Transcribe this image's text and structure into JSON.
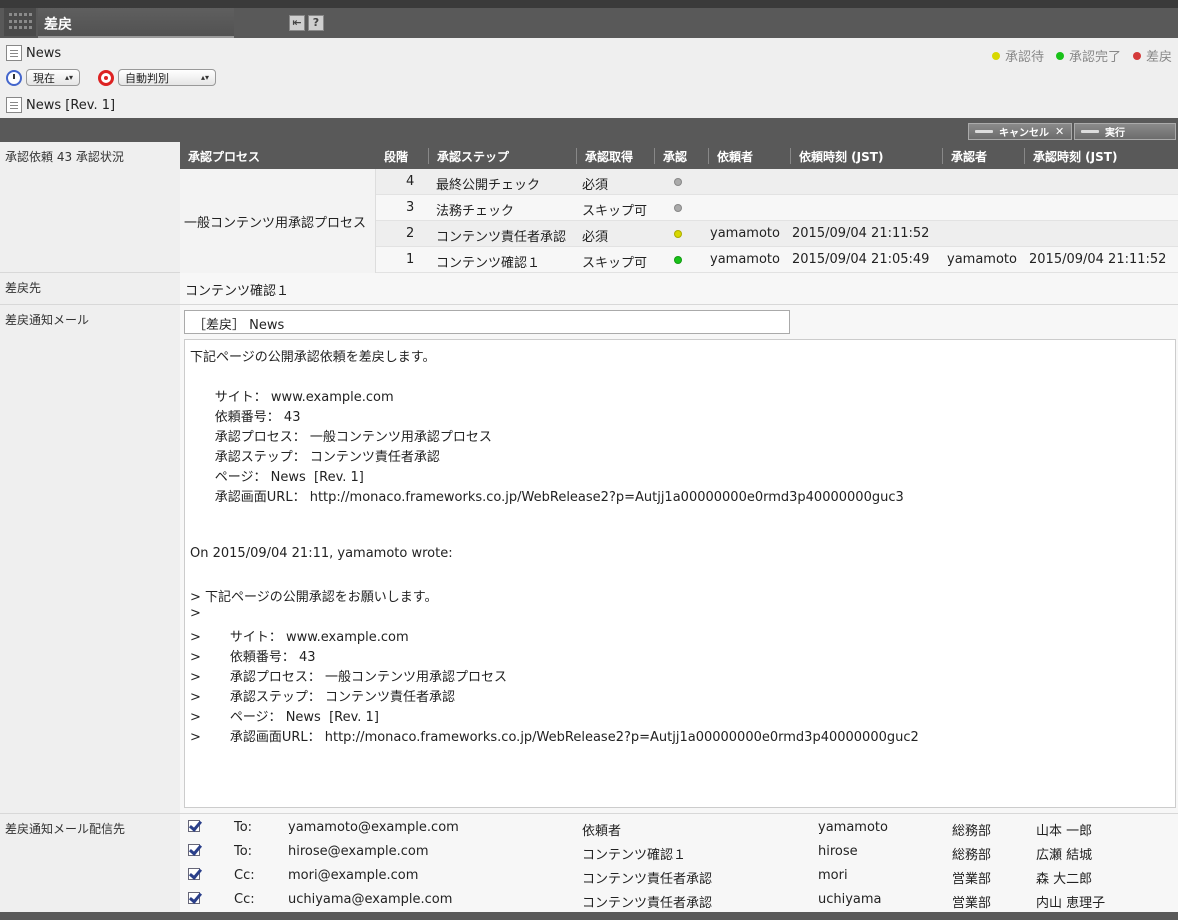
{
  "window": {
    "title": "差戻"
  },
  "header": {
    "page_name": "News",
    "time_select": "現在",
    "mode_select": "自動判別",
    "revision": "News [Rev. 1]",
    "legend": [
      {
        "label": "承認待",
        "color": "#d8d800"
      },
      {
        "label": "承認完了",
        "color": "#19c219"
      },
      {
        "label": "差戻",
        "color": "#d43a3a"
      }
    ]
  },
  "toolbar": {
    "cancel_label": "キャンセル",
    "execute_label": "実行"
  },
  "approval": {
    "label": "承認依頼 43 承認状況",
    "columns": [
      "承認プロセス",
      "段階",
      "承認ステップ",
      "承認取得",
      "承認",
      "依頼者",
      "依頼時刻 (JST)",
      "承認者",
      "承認時刻 (JST)"
    ],
    "process_name": "一般コンテンツ用承認プロセス",
    "rows": [
      {
        "stage": "4",
        "step": "最終公開チェック",
        "requirement": "必須",
        "status_color": "#aaaaaa",
        "requester": "",
        "request_time": "",
        "approver": "",
        "approve_time": ""
      },
      {
        "stage": "3",
        "step": "法務チェック",
        "requirement": "スキップ可",
        "status_color": "#aaaaaa",
        "requester": "",
        "request_time": "",
        "approver": "",
        "approve_time": ""
      },
      {
        "stage": "2",
        "step": "コンテンツ責任者承認",
        "requirement": "必須",
        "status_color": "#d8d800",
        "requester": "yamamoto",
        "request_time": "2015/09/04 21:11:52",
        "approver": "",
        "approve_time": ""
      },
      {
        "stage": "1",
        "step": "コンテンツ確認１",
        "requirement": "スキップ可",
        "status_color": "#19c219",
        "requester": "yamamoto",
        "request_time": "2015/09/04 21:05:49",
        "approver": "yamamoto",
        "approve_time": "2015/09/04 21:11:52"
      }
    ]
  },
  "return_to": {
    "label": "差戻先",
    "value": "コンテンツ確認１"
  },
  "mail": {
    "label": "差戻通知メール",
    "subject": "［差戻］ News",
    "body_lines": [
      "下記ページの公開承認依頼を差戻します。",
      "",
      "      サイト： www.example.com",
      "      依頼番号： 43",
      "      承認プロセス： 一般コンテンツ用承認プロセス",
      "      承認ステップ： コンテンツ責任者承認",
      "      ページ： News  [Rev. 1]",
      "      承認画面URL： http://monaco.frameworks.co.jp/WebRelease2?p=Autjj1a00000000e0rmd3p40000000guc3",
      "",
      "",
      "On 2015/09/04 21:11, yamamoto wrote:",
      "",
      "> 下記ページの公開承認をお願いします。",
      ">",
      ">       サイト： www.example.com",
      ">       依頼番号： 43",
      ">       承認プロセス： 一般コンテンツ用承認プロセス",
      ">       承認ステップ： コンテンツ責任者承認",
      ">       ページ： News  [Rev. 1]",
      ">       承認画面URL： http://monaco.frameworks.co.jp/WebRelease2?p=Autjj1a00000000e0rmd3p40000000guc2"
    ]
  },
  "recipients": {
    "label": "差戻通知メール配信先",
    "rows": [
      {
        "type": "To:",
        "email": "yamamoto@example.com",
        "role": "依頼者",
        "user": "yamamoto",
        "dept": "総務部",
        "name": "山本 一郎",
        "checked": true
      },
      {
        "type": "To:",
        "email": "hirose@example.com",
        "role": "コンテンツ確認１",
        "user": "hirose",
        "dept": "総務部",
        "name": "広瀬 結城",
        "checked": true
      },
      {
        "type": "Cc:",
        "email": "mori@example.com",
        "role": "コンテンツ責任者承認",
        "user": "mori",
        "dept": "営業部",
        "name": "森 大二郎",
        "checked": true
      },
      {
        "type": "Cc:",
        "email": "uchiyama@example.com",
        "role": "コンテンツ責任者承認",
        "user": "uchiyama",
        "dept": "営業部",
        "name": "内山 恵理子",
        "checked": true
      }
    ]
  }
}
